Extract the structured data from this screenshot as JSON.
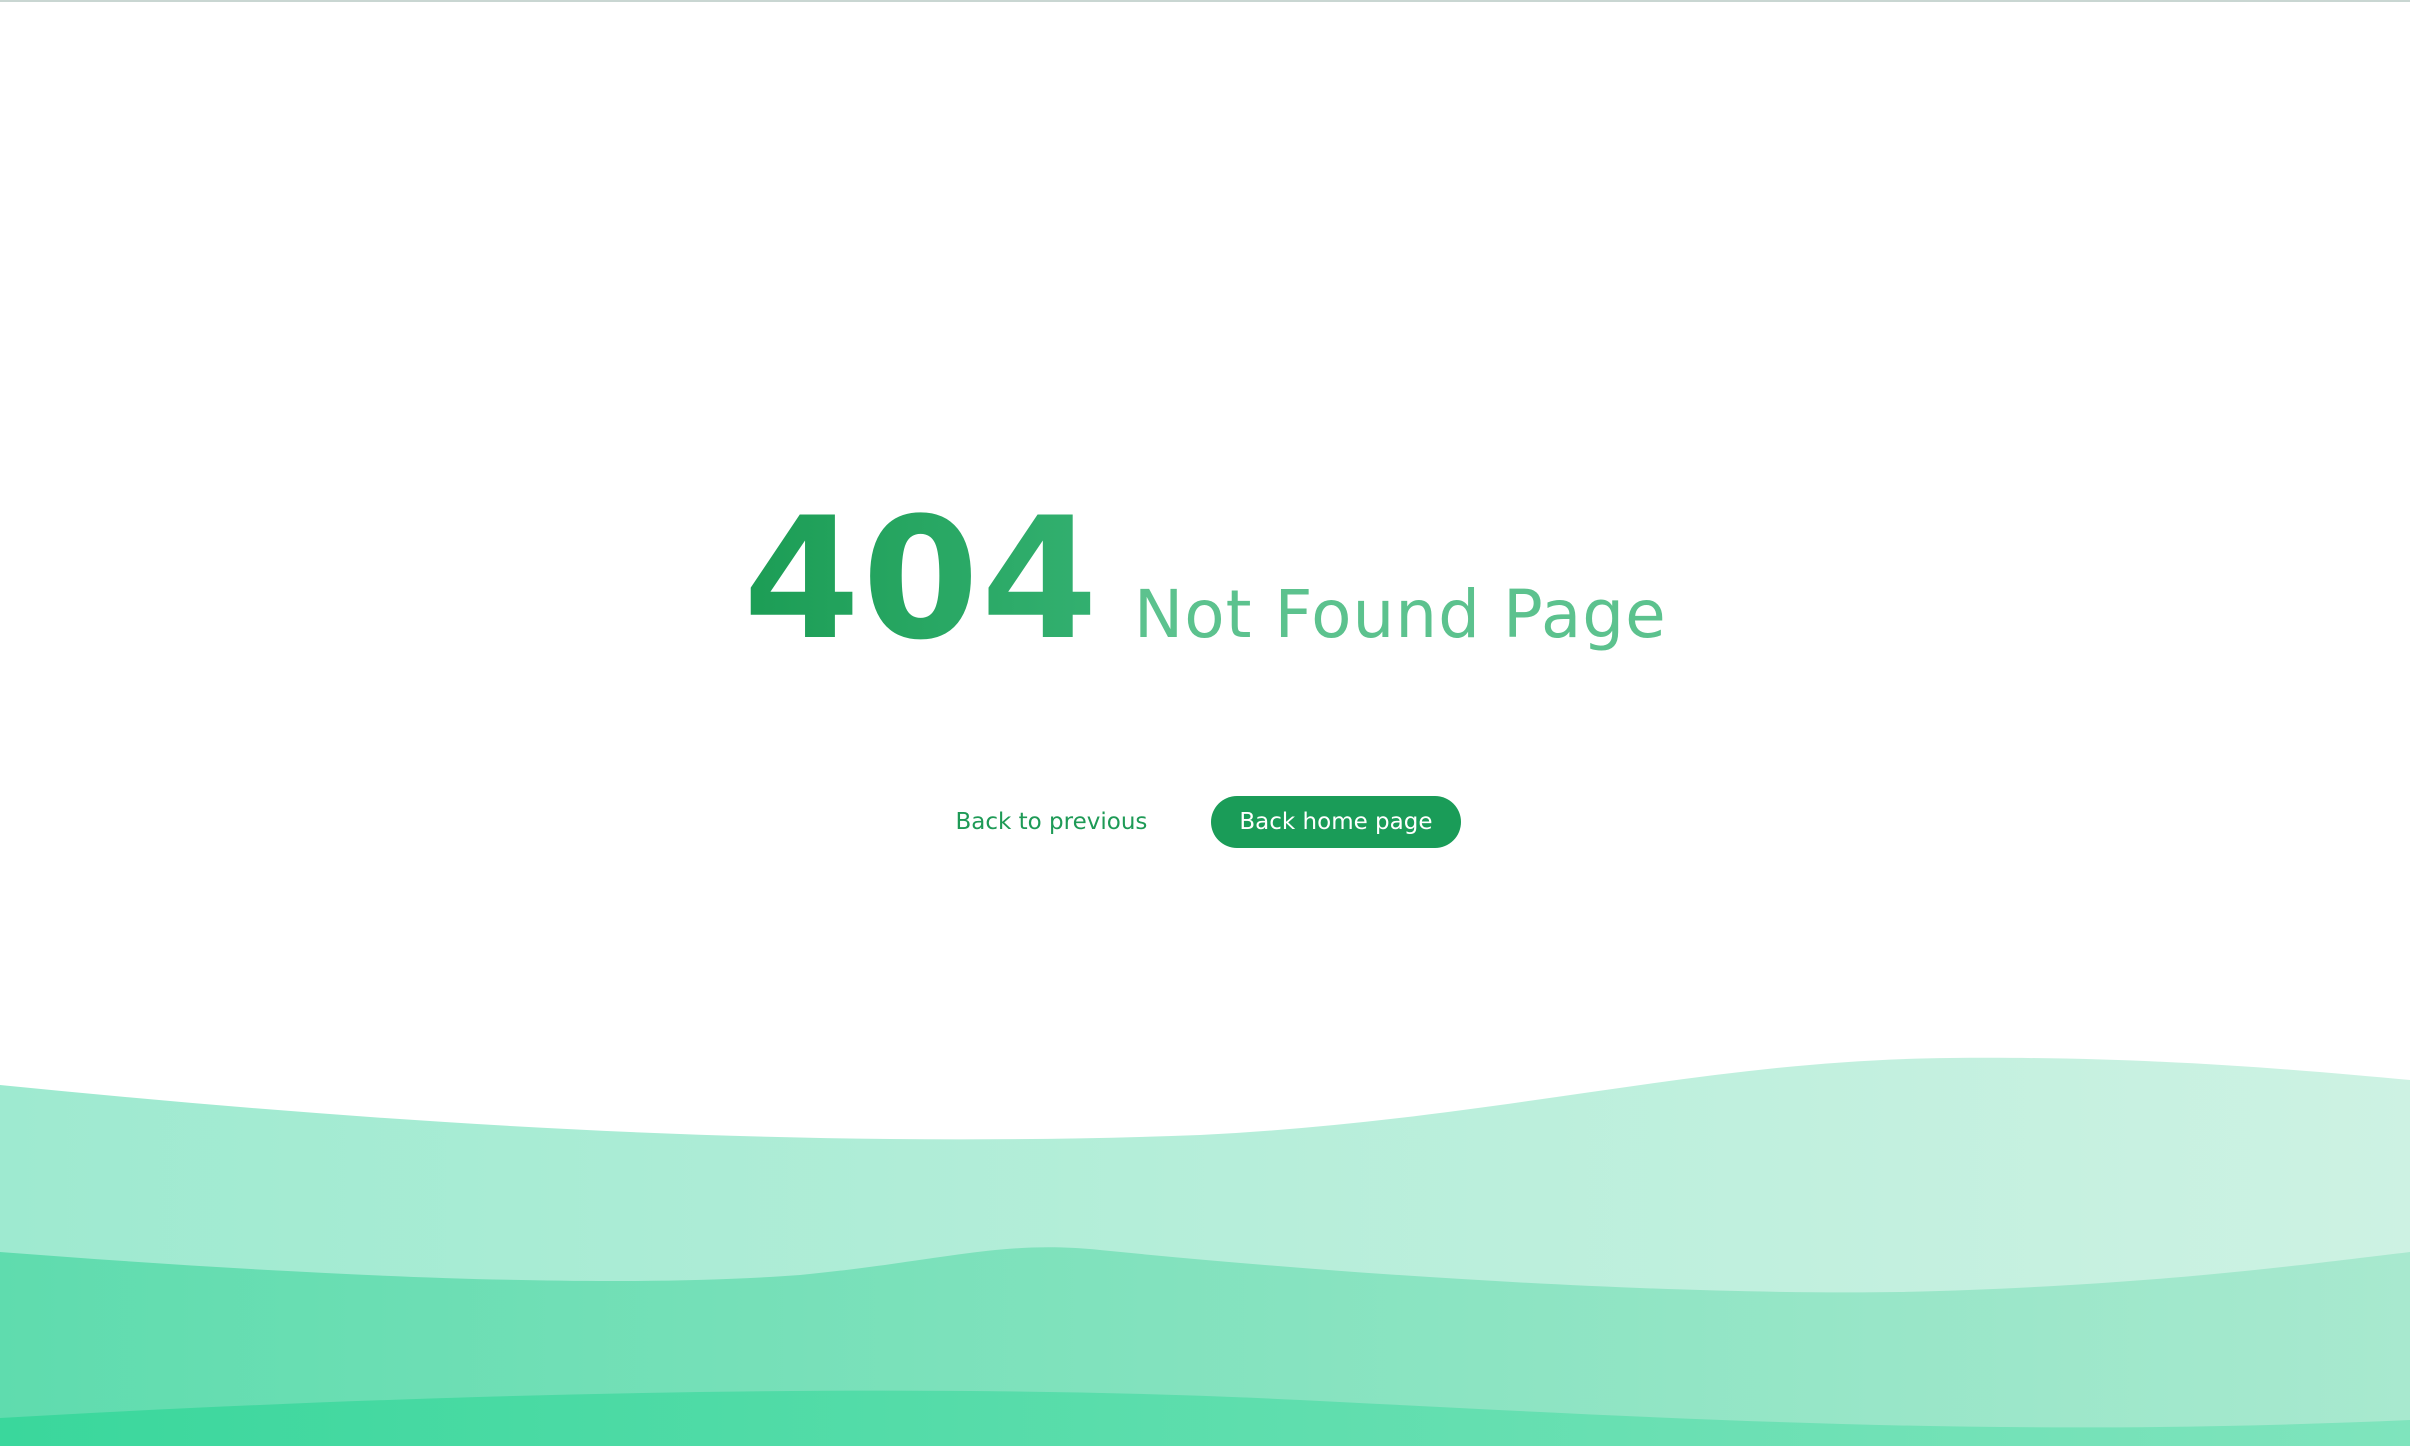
{
  "error": {
    "code": "404",
    "message": "Not Found Page"
  },
  "actions": {
    "back_previous_label": "Back to previous",
    "back_home_label": "Back home page"
  },
  "colors": {
    "primary": "#1a9c58",
    "text_light": "#5cc28e",
    "wave_light": "#c9f0e0",
    "wave_mid": "#8fe4c3",
    "wave_dark": "#3fd69c"
  }
}
